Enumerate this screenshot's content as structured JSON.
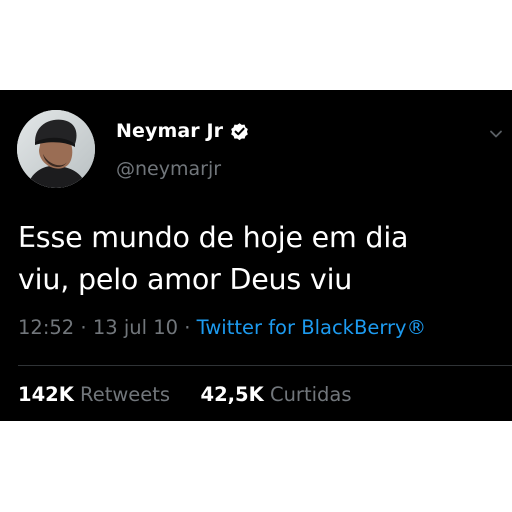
{
  "author": {
    "display_name": "Neymar Jr",
    "handle": "@neymarjr",
    "verified_icon": "verified-badge-icon",
    "avatar_icon": "avatar"
  },
  "tweet": {
    "text_line_1": "Esse mundo de hoje em dia",
    "text_line_2": "viu, pelo amor Deus viu",
    "time": "12:52",
    "separator": "·",
    "date": "13 jul 10",
    "source": "Twitter for BlackBerry®"
  },
  "stats": {
    "retweets_count": "142K",
    "retweets_label": "Retweets",
    "likes_count": "42,5K",
    "likes_label": "Curtidas"
  },
  "menu": {
    "icon": "chevron-down-icon"
  },
  "colors": {
    "background": "#000000",
    "text_primary": "#ffffff",
    "text_secondary": "#71767b",
    "link": "#1d9bf0",
    "divider": "#2f3336"
  }
}
